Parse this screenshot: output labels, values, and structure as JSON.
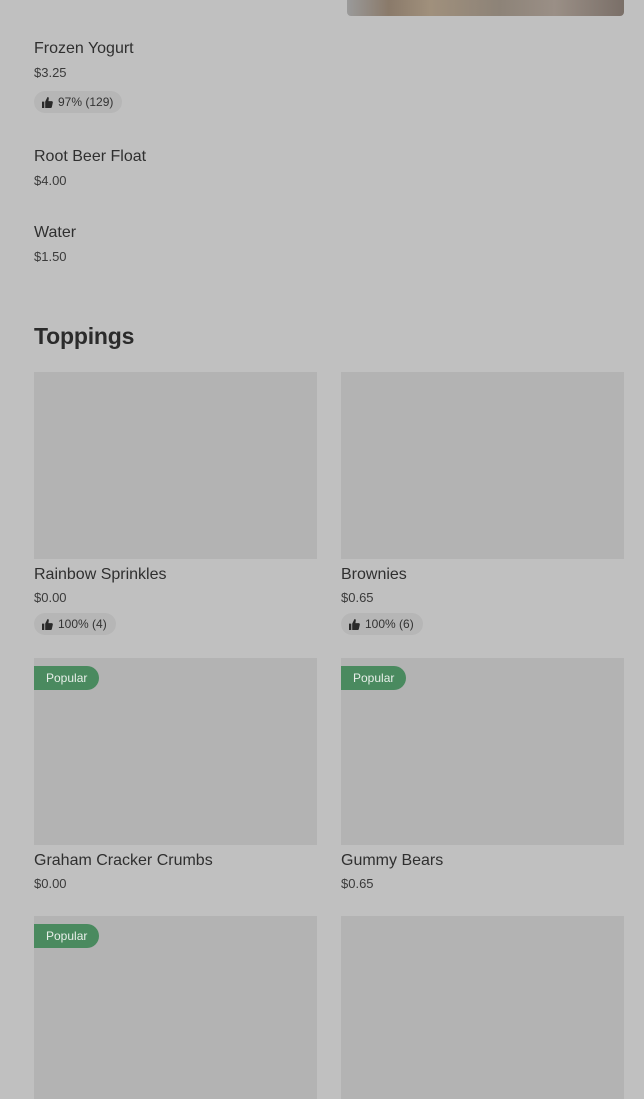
{
  "items": [
    {
      "name": "Frozen Yogurt",
      "price": "$3.25",
      "rating": "97% (129)"
    },
    {
      "name": "Root Beer Float",
      "price": "$4.00"
    },
    {
      "name": "Water",
      "price": "$1.50"
    }
  ],
  "toppings": {
    "title": "Toppings",
    "cards": [
      {
        "name": "Rainbow Sprinkles",
        "price": "$0.00",
        "rating": "100% (4)"
      },
      {
        "name": "Brownies",
        "price": "$0.65",
        "rating": "100% (6)"
      },
      {
        "name": "Graham Cracker Crumbs",
        "price": "$0.00",
        "badge": "Popular"
      },
      {
        "name": "Gummy Bears",
        "price": "$0.65",
        "badge": "Popular"
      },
      {
        "badge": "Popular"
      }
    ]
  },
  "icons": {
    "rating_icon": "thumbs-up-icon"
  },
  "colors": {
    "badge_bg": "#4a8a5f",
    "background": "#c0c0c0",
    "image_placeholder": "#b3b3b3"
  }
}
